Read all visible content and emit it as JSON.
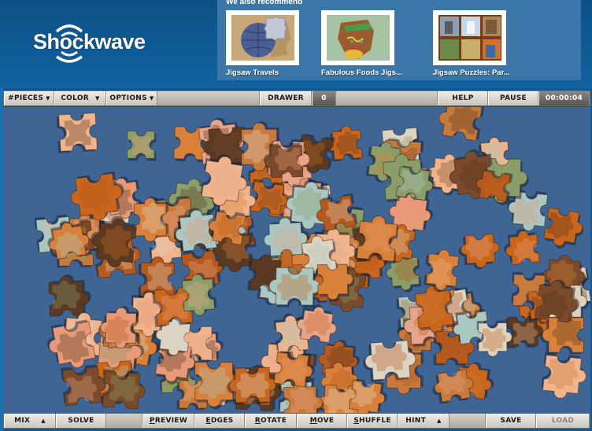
{
  "header": {
    "logo_text": "Shockwave",
    "recommend_title": "We also recommend",
    "recommendations": [
      {
        "label": "Jigsaw Travels",
        "thumb": "globe-puzzle-thumbnail"
      },
      {
        "label": "Fabulous Foods Jigs...",
        "thumb": "gingerbread-puzzle-thumbnail"
      },
      {
        "label": "Jigsaw Puzzles: Par...",
        "thumb": "photo-grid-puzzle-thumbnail"
      }
    ]
  },
  "top_toolbar": {
    "pieces_label": "#PIECES",
    "color_label": "COLOR",
    "options_label": "OPTIONS",
    "drawer_label": "DRAWER",
    "drawer_count": "0",
    "help_label": "HELP",
    "pause_label": "PAUSE",
    "timer": "00:00:04"
  },
  "bottom_toolbar": {
    "mix_label": "MIX",
    "solve_label": "SOLVE",
    "preview_label": "PREVIEW",
    "edges_label": "EDGES",
    "rotate_label": "ROTATE",
    "move_label": "MOVE",
    "shuffle_label": "SHUFFLE",
    "hint_label": "HINT",
    "save_label": "SAVE",
    "load_label": "LOAD"
  },
  "board": {
    "background_color": "#3e6594",
    "piece_palette": [
      "#c9661c",
      "#d9813a",
      "#e89a78",
      "#b45a1e",
      "#7a4a2a",
      "#dcd3c2",
      "#8a9e6a",
      "#a9c8c2",
      "#e6a58a",
      "#5a3a22",
      "#c87a3c",
      "#f0b48c"
    ]
  }
}
